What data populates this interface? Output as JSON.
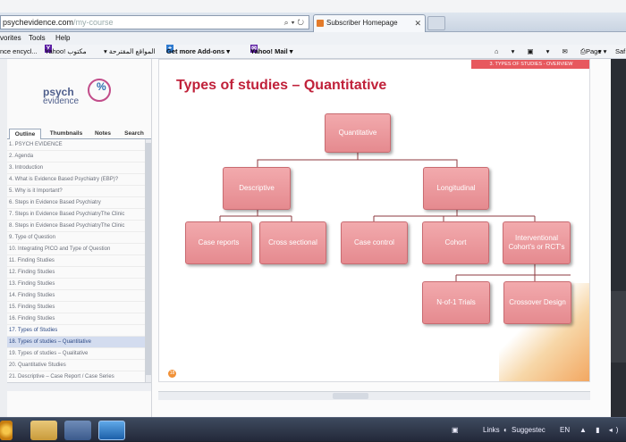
{
  "browser": {
    "address": {
      "domain": "psychevidence.com",
      "rest": "/my-course"
    },
    "tab_title": "Subscriber Homepage",
    "menu": [
      "vorites",
      "Tools",
      "Help"
    ],
    "favorites": [
      {
        "label": "nce encycl...",
        "type": "link"
      },
      {
        "label": "Yahoo! مكتوب",
        "type": "yahoo"
      },
      {
        "label": "▾ المواقع المقترحة",
        "type": "link"
      },
      {
        "label": "Get more Add-ons ▾",
        "type": "bold"
      },
      {
        "label": "Yahoo! Mail ▾",
        "type": "yahoo"
      }
    ],
    "toolbar_right": {
      "page": "Page ▾",
      "safety": "Saf"
    }
  },
  "sidebar": {
    "logo": {
      "line1": "psych",
      "line2": "evidence"
    },
    "tabs": [
      "Outline",
      "Thumbnails",
      "Notes",
      "Search"
    ],
    "outline": [
      "1. PSYCH EVIDENCE",
      "2. Agenda",
      "3. Introduction",
      "4. What is Evidence Based Psychiatry (EBP)?",
      "5. Why is it Important?",
      "6. Steps in Evidence Based Psychiatry",
      "7. Steps in Evidence Based PsychiatryThe Clinic",
      "8. Steps in Evidence Based PsychiatryThe Clinic",
      "9. Type of Question",
      "10. Integrating PICO and Type of Question",
      "11. Finding Studies",
      "12. Finding Studies",
      "13. Finding Studies",
      "14. Finding Studies",
      "15. Finding Studies",
      "16. Finding Studies",
      "17. Types of Studies",
      "18. Types of studies – Quantitative",
      "19. Types of studies – Qualitative",
      "20. Quantitative Studies",
      "21. Descriptive – Case Report / Case Series"
    ],
    "selected_index": 17
  },
  "slide": {
    "header_label": "3. TYPES OF STUDIES - OVERVIEW",
    "title": "Types of studies – Quantitative",
    "slide_number": "18",
    "nodes": {
      "root": "Quantitative",
      "descriptive": "Descriptive",
      "longitudinal": "Longitudinal",
      "case_reports": "Case reports",
      "cross_sectional": "Cross sectional",
      "case_control": "Case control",
      "cohort": "Cohort",
      "interventional": "Interventional Cohort's or RCT's",
      "n_of_1": "N-of-1 Trials",
      "crossover": "Crossover Design"
    }
  },
  "taskbar": {
    "links": "Links",
    "suggested": "Suggestec",
    "lang": "EN"
  },
  "colors": {
    "node": "#e58a8f",
    "title": "#c0213a",
    "accent_bar": "#e7585e"
  }
}
